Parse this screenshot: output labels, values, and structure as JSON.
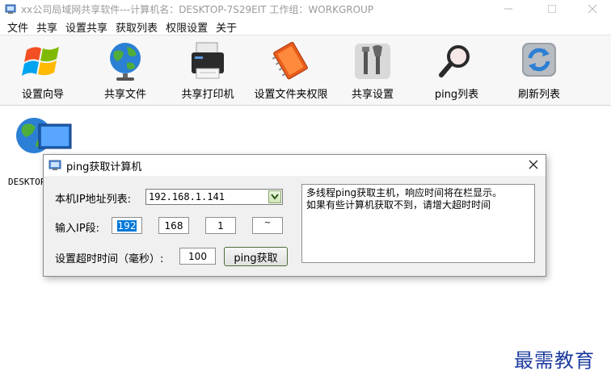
{
  "window": {
    "title": "xx公司局域网共享软件---计算机名：DESKTOP-7S29EIT  工作组：WORKGROUP"
  },
  "menu": [
    "文件",
    "共享",
    "设置共享",
    "获取列表",
    "权限设置",
    "关于"
  ],
  "toolbar": [
    {
      "label": "设置向导",
      "icon": "windows-logo-icon"
    },
    {
      "label": "共享文件",
      "icon": "globe-icon"
    },
    {
      "label": "共享打印机",
      "icon": "printer-icon"
    },
    {
      "label": "设置文件夹权限",
      "icon": "notebook-icon"
    },
    {
      "label": "共享设置",
      "icon": "tools-icon"
    },
    {
      "label": "ping列表",
      "icon": "magnifier-icon"
    },
    {
      "label": "刷新列表",
      "icon": "refresh-icon"
    }
  ],
  "computer_list": [
    {
      "name": "DESKTOP",
      "icon": "network-computer-icon"
    }
  ],
  "dialog": {
    "title": "ping获取计算机",
    "ip_list_label": "本机IP地址列表:",
    "ip_list_value": "192.168.1.141",
    "ip_segment_label": "输入IP段:",
    "ip_segment": [
      "192",
      "168",
      "1",
      "~"
    ],
    "timeout_label": "设置超时时间（毫秒）:",
    "timeout_value": "100",
    "ping_button": "ping获取",
    "info_text": [
      "多线程ping获取主机，响应时间将在栏显示。",
      "如果有些计算机获取不到，请增大超时时间"
    ]
  },
  "watermark": "最需教育",
  "colors": {
    "selection": "#0078d7",
    "watermark": "#1e3c9f",
    "combo_button": "#cfe6b6"
  }
}
